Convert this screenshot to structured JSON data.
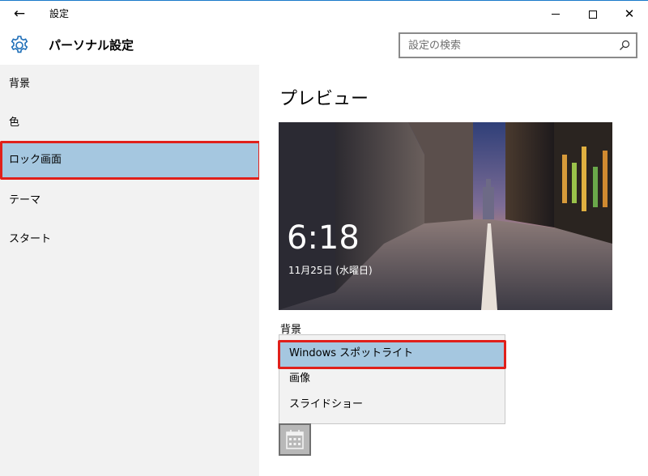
{
  "window": {
    "title": "設定",
    "back_icon": "←",
    "close_icon": "✕"
  },
  "header": {
    "title": "パーソナル設定",
    "search_placeholder": "設定の検索"
  },
  "sidebar": {
    "items": [
      {
        "label": "背景"
      },
      {
        "label": "色"
      },
      {
        "label": "ロック画面"
      },
      {
        "label": "テーマ"
      },
      {
        "label": "スタート"
      }
    ],
    "selected_index": 2
  },
  "main": {
    "section_title": "プレビュー",
    "preview": {
      "time": "6:18",
      "date": "11月25日 (水曜日)"
    },
    "background": {
      "label": "背景",
      "options": [
        {
          "label": "Windows スポットライト"
        },
        {
          "label": "画像"
        },
        {
          "label": "スライドショー"
        }
      ],
      "selected_index": 0
    }
  },
  "colors": {
    "accent_blue": "#a5c7e0",
    "highlight_red": "#e0201b",
    "sidebar_bg": "#f2f2f2",
    "titlebar_border": "#1979ca"
  }
}
